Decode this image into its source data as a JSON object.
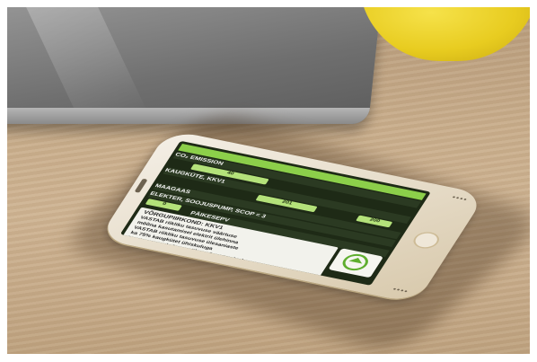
{
  "scene": {
    "description_objects": [
      "laptop-corner",
      "yellow-mug",
      "smartphone"
    ],
    "colors": {
      "table": "#c9ae8c",
      "laptop": "#7a7a7a",
      "mug": "#e8cc20",
      "phone_body": "#ece3d3",
      "screen_green": "#8ccf4a"
    }
  },
  "phone_screen": {
    "row1": "",
    "row2": "CO₂ EMISSION",
    "field_a": "40",
    "row3": "KAUGKÜTE, KKV1",
    "field_b": "201",
    "field_c": "200",
    "row4": "MAAGAAS",
    "row5": "ELEKTER, SOOJUSPUMP, SCOP = 3",
    "field_d": "0",
    "row6": "PÄIKESEPV",
    "panel_heading": "VÕRGUPIIRKOND: KKV1",
    "panel_line1": "VASTAB riikliku tasuvuse väärtuse",
    "panel_line2": "mõõna kasutamisel elektrit ülehinna",
    "panel_line3": "VASTAB riikliku tasuvuse ülesaniaste",
    "panel_line4": "ka 75% kaugkütet ühiskuluga",
    "panel_line5": "taastuv energia ja omaüksus kasutamisel"
  }
}
